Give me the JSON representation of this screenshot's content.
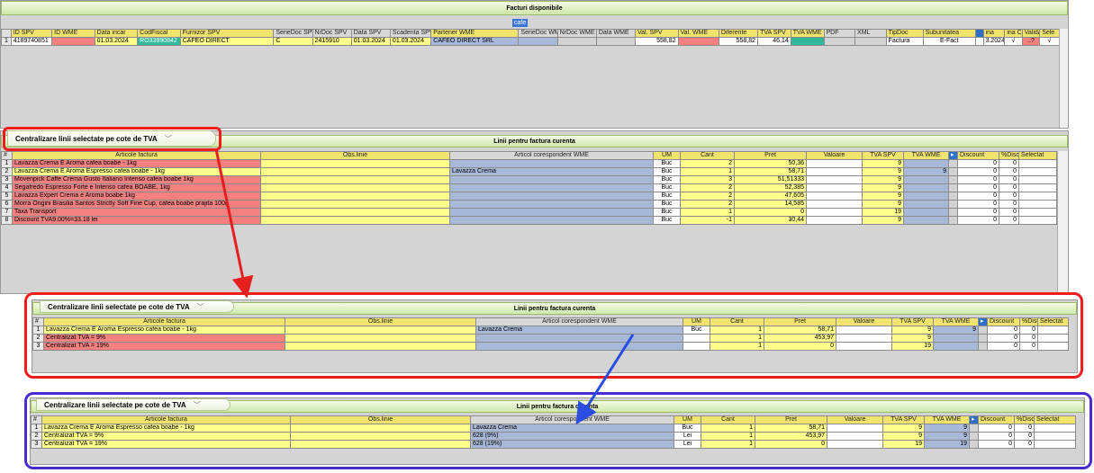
{
  "top": {
    "title": "Facturi disponibile",
    "search": "cafe",
    "columns": [
      "",
      "ID SPV",
      "ID WME",
      "Data incar",
      "CodFiscal",
      "Furnizor SPV",
      "SerieDoc SPV",
      "NrDoc SPV",
      "Data SPV",
      "Scadenta SPV",
      "Partener WME",
      "SerieDoc WME",
      "NrDoc WME",
      "Data WME",
      "Val. SPV",
      "Val. WME",
      "Diferente",
      "TVA SPV",
      "TVA WME",
      "PDF",
      "XML",
      "TipDoc",
      "Subunitatea",
      "",
      "ina",
      "ina C",
      "Valida",
      "Sele"
    ],
    "row": [
      "1",
      "4189740851",
      "",
      "01.03.2024",
      "RO33990842",
      "CAFEO DIRECT",
      "C",
      "2415910",
      "01.03.2024",
      "01.03.2024",
      "CAFEO DIRECT SRL",
      "",
      "",
      "",
      "558,82",
      "",
      "558,82",
      "46,14",
      "",
      "",
      "",
      "Factura",
      "E-Fact",
      "3.2024",
      "√",
      "..?",
      "√"
    ]
  },
  "tab_label": "Centralizare linii selectate pe cote de TVA",
  "lines_title": "Linii pentru factura curenta",
  "line_columns": {
    "num": "#",
    "articol": "Articole factura",
    "obs": "Obs.linie",
    "corresp": "Articol corespondent WME",
    "um": "UM",
    "cant": "Cant",
    "pret": "Pret",
    "valoare": "Valoare",
    "tva_spv": "TVA SPV",
    "tva_wme": "TVA WME",
    "discount": "Discount",
    "pdisc": "%Disc",
    "selectat": "Selectat"
  },
  "panel1_rows": [
    {
      "n": "1",
      "art": "Lavazza Crema E Aroma cafea boabe - 1kg",
      "obs": "",
      "cor": "",
      "um": "Buc",
      "cant": "2",
      "pret": "50,36",
      "val": "",
      "tvas": "9",
      "tvaw": "",
      "disc": "0",
      "pd": "0"
    },
    {
      "n": "2",
      "art": "Lavazza Crema E Aroma Espresso cafea boabe - 1kg",
      "obs": "",
      "cor": "Lavazza Crema",
      "um": "Buc",
      "cant": "1",
      "pret": "58,71",
      "val": "",
      "tvas": "9",
      "tvaw": "9",
      "disc": "0",
      "pd": "0"
    },
    {
      "n": "3",
      "art": "Movenpick Caffe Crema Gusto Italiano Intenso  cafea boabe 1kg",
      "obs": "",
      "cor": "",
      "um": "Buc",
      "cant": "3",
      "pret": "51,51333",
      "val": "",
      "tvas": "9",
      "tvaw": "",
      "disc": "0",
      "pd": "0"
    },
    {
      "n": "4",
      "art": "Segafredo Espresso Forte e Intenso cafea BOABE, 1kg",
      "obs": "",
      "cor": "",
      "um": "Buc",
      "cant": "2",
      "pret": "52,385",
      "val": "",
      "tvas": "9",
      "tvaw": "",
      "disc": "0",
      "pd": "0"
    },
    {
      "n": "5",
      "art": "Lavazza Expert Crema e Aroma boabe 1kg",
      "obs": "",
      "cor": "",
      "um": "Buc",
      "cant": "2",
      "pret": "47,605",
      "val": "",
      "tvas": "9",
      "tvaw": "",
      "disc": "0",
      "pd": "0"
    },
    {
      "n": "6",
      "art": "Morra Origini Brasilia Santos Strictly Soft Fine Cup, cafea boabe prajita 100g",
      "obs": "",
      "cor": "",
      "um": "Buc",
      "cant": "2",
      "pret": "14,585",
      "val": "",
      "tvas": "9",
      "tvaw": "",
      "disc": "0",
      "pd": "0"
    },
    {
      "n": "7",
      "art": "Taxa Transport",
      "obs": "",
      "cor": "",
      "um": "Buc",
      "cant": "1",
      "pret": "0",
      "val": "",
      "tvas": "19",
      "tvaw": "",
      "disc": "0",
      "pd": "0"
    },
    {
      "n": "8",
      "art": "Discount TVA9.00%=33.18 lei",
      "obs": "",
      "cor": "",
      "um": "Buc",
      "cant": "-1",
      "pret": "30,44",
      "val": "",
      "tvas": "9",
      "tvaw": "",
      "disc": "0",
      "pd": "0"
    }
  ],
  "panel2_rows": [
    {
      "n": "1",
      "art": "Lavazza Crema E Aroma Espresso cafea boabe - 1kg",
      "obs": "",
      "cor": "Lavazza Crema",
      "um": "Buc",
      "cant": "1",
      "pret": "58,71",
      "val": "",
      "tvas": "9",
      "tvaw": "9",
      "disc": "0",
      "pd": "0"
    },
    {
      "n": "2",
      "art": "Centralizat TVA = 9%",
      "obs": "",
      "cor": "",
      "um": "",
      "cant": "1",
      "pret": "453,97",
      "val": "",
      "tvas": "9",
      "tvaw": "",
      "disc": "0",
      "pd": "0"
    },
    {
      "n": "3",
      "art": "Centralizat TVA = 19%",
      "obs": "",
      "cor": "",
      "um": "",
      "cant": "1",
      "pret": "0",
      "val": "",
      "tvas": "19",
      "tvaw": "",
      "disc": "0",
      "pd": "0"
    }
  ],
  "panel3_rows": [
    {
      "n": "1",
      "art": "Lavazza Crema E Aroma Espresso cafea boabe - 1kg",
      "obs": "",
      "cor": "Lavazza Crema",
      "um": "Buc",
      "cant": "1",
      "pret": "58,71",
      "val": "",
      "tvas": "9",
      "tvaw": "9",
      "disc": "0",
      "pd": "0"
    },
    {
      "n": "2",
      "art": "Centralizat TVA = 9%",
      "obs": "",
      "cor": "628 (9%)",
      "um": "Lei",
      "cant": "1",
      "pret": "453,97",
      "val": "",
      "tvas": "9",
      "tvaw": "9",
      "disc": "0",
      "pd": "0"
    },
    {
      "n": "3",
      "art": "Centralizat TVA = 19%",
      "obs": "",
      "cor": "628 (19%)",
      "um": "Lei",
      "cant": "1",
      "pret": "0",
      "val": "",
      "tvas": "19",
      "tvaw": "19",
      "disc": "0",
      "pd": "0"
    }
  ],
  "colors": {
    "red_frame": "#ee1c1c",
    "purple_frame": "#4a2bd0",
    "red_arrow": "#e81f1f",
    "blue_arrow": "#2a4ce0"
  }
}
